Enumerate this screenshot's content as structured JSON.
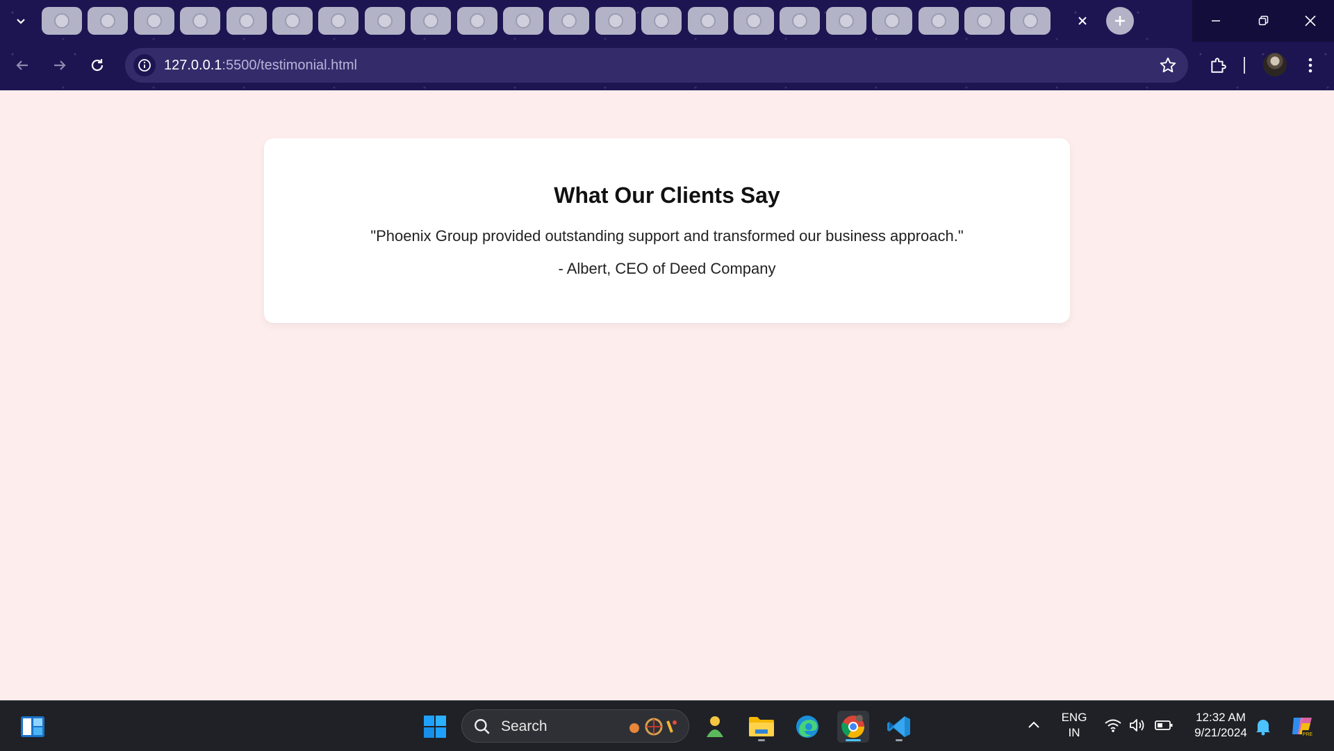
{
  "browser": {
    "tab_count": 22,
    "url_host": "127.0.0.1",
    "url_path": ":5500/testimonial.html"
  },
  "page": {
    "heading": "What Our Clients Say",
    "quote": "\"Phoenix Group provided outstanding support and transformed our business approach.\"",
    "author": "- Albert, CEO of Deed Company"
  },
  "taskbar": {
    "search_label": "Search",
    "language_line1": "ENG",
    "language_line2": "IN",
    "time": "12:32 AM",
    "date": "9/21/2024"
  },
  "colors": {
    "page_background": "#fdeded",
    "chrome_background": "#1c1552",
    "card_background": "#ffffff"
  }
}
